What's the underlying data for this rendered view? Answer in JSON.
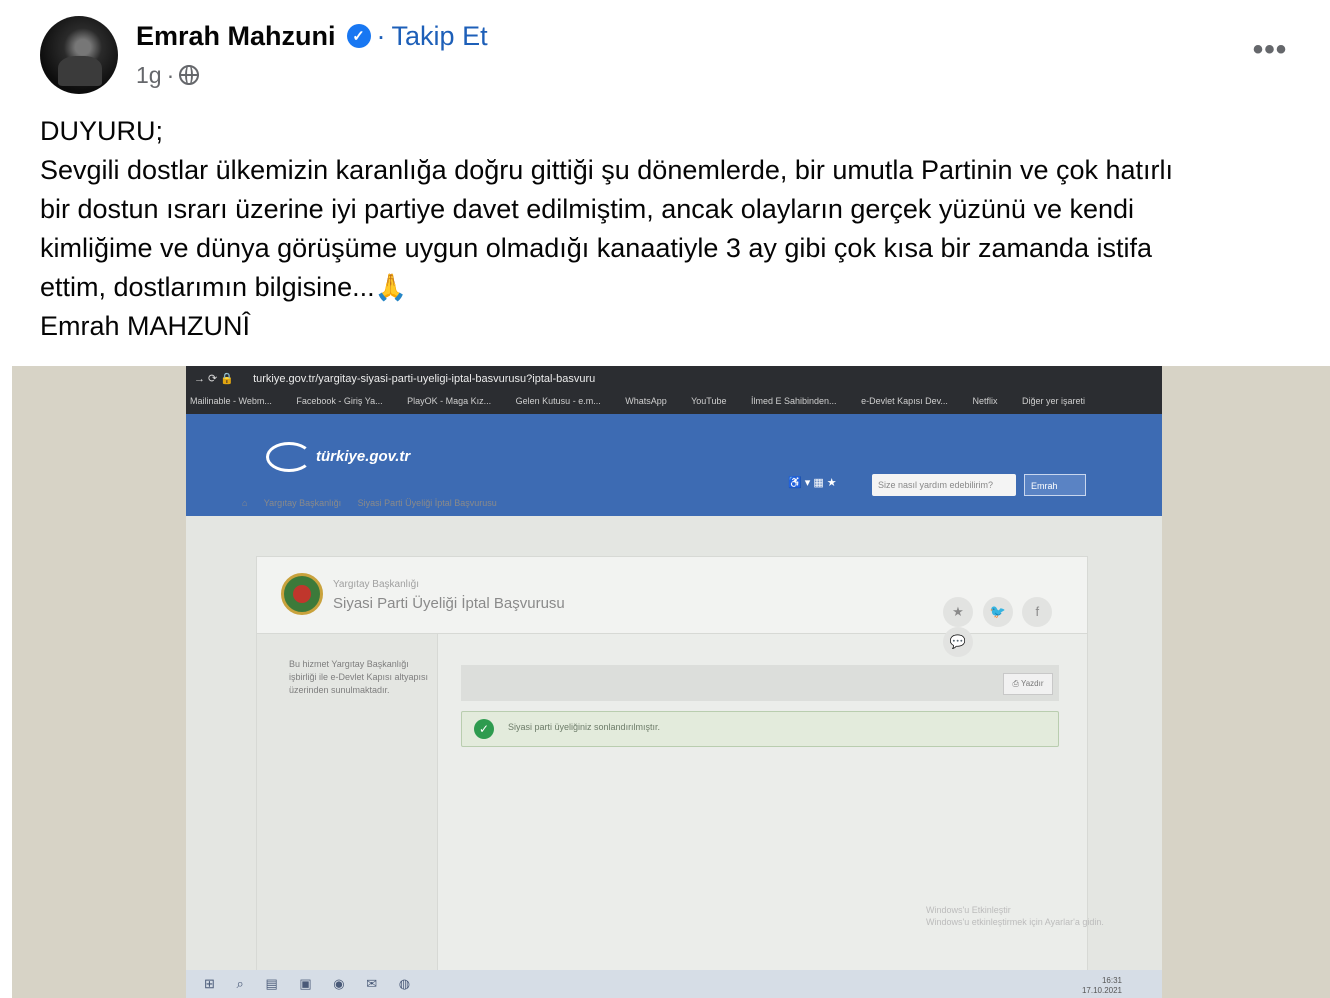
{
  "post": {
    "author": "Emrah Mahzuni",
    "separator": "·",
    "follow_label": "Takip Et",
    "time": "1g",
    "time_dot": "·",
    "more_label": "•••",
    "lines": [
      "DUYURU;",
      "Sevgili dostlar ülkemizin karanlığa doğru gittiği şu dönemlerde, bir umutla Partinin ve çok hatırlı",
      "bir dostun ısrarı  üzerine iyi partiye davet edilmiştim, ancak olayların gerçek yüzünü ve kendi",
      "kimliğime ve dünya görüşüme uygun olmadığı kanaatiyle 3 ay gibi çok kısa bir zamanda istifa",
      "ettim, dostlarımın bilgisine...",
      "Emrah MAHZUNÎ"
    ],
    "emoji": "🙏"
  },
  "photo": {
    "browser": {
      "url": "turkiye.gov.tr/yargitay-siyasi-parti-uyeligi-iptal-basvurusu?iptal-basvuru",
      "bookmarks": [
        "Mailinable - Webm...",
        "Facebook - Giriş Ya...",
        "PlayOK - Maga Kız...",
        "Gelen Kutusu - e.m...",
        "WhatsApp",
        "YouTube",
        "İlmed E Sahibinden...",
        "e-Devlet Kapısı Dev...",
        "Netflix",
        "Diğer yer işareti"
      ]
    },
    "gov": {
      "logo": "türkiye.gov.tr",
      "search_placeholder": "Size nasıl yardım edebilirim?",
      "login": "Emrah",
      "tools": "♿ ▾   ▦ ★",
      "breadcrumb": [
        "⌂",
        "Yargıtay Başkanlığı",
        "Siyasi Parti Üyeliği İptal Başvurusu"
      ],
      "institution": "Yargıtay Başkanlığı",
      "service_title": "Siyasi Parti Üyeliği İptal Başvurusu",
      "share_icons": [
        "★",
        "🐦",
        "f",
        "💬"
      ],
      "side_note": "Bu hizmet Yargıtay Başkanlığı işbirliği ile e-Devlet Kapısı altyapısı üzerinden sunulmaktadır.",
      "print_label": "⎙ Yazdır",
      "success_icon": "✓",
      "success_message": "Siyasi parti üyeliğiniz sonlandırılmıştır.",
      "watermark_line1": "Windows'u Etkinleştir",
      "watermark_line2": "Windows'u etkinleştirmek için Ayarlar'a gidin.",
      "taskbar_icons": [
        "⊞",
        "⌕",
        "▤",
        "▣",
        "◉",
        "✉",
        "◍"
      ],
      "tray_time": "16:31",
      "tray_date": "17.10.2021"
    }
  }
}
